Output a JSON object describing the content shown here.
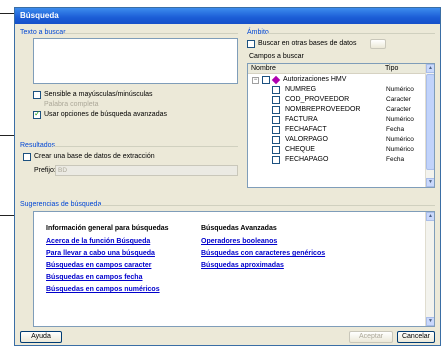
{
  "window": {
    "title": "Búsqueda"
  },
  "left": {
    "text_group_title": "Texto a buscar",
    "text_value": "",
    "case_sensitive": {
      "label": "Sensible a mayúsculas/minúsculas",
      "checked": false
    },
    "whole_word": {
      "label": "Palabra completa",
      "checked": false,
      "disabled": true
    },
    "advanced": {
      "label": "Usar opciones de búsqueda avanzadas",
      "checked": true
    },
    "results_group_title": "Resultados",
    "create_db": {
      "label": "Crear una base de datos de extracción",
      "checked": false
    },
    "prefix_label": "Prefijo:",
    "prefix_value": "BD"
  },
  "right": {
    "scope_group_title": "Ámbito",
    "other_db": {
      "label": "Buscar en otras bases de datos",
      "checked": false
    },
    "fields_title": "Campos a buscar",
    "columns": {
      "name": "Nombre",
      "type": "Tipo"
    },
    "root": "Autorizaciones HMV",
    "fields": [
      {
        "name": "NUMREG",
        "type": "Numérico"
      },
      {
        "name": "COD_PROVEEDOR",
        "type": "Caracter"
      },
      {
        "name": "NOMBREPROVEEDOR",
        "type": "Caracter"
      },
      {
        "name": "FACTURA",
        "type": "Numérico"
      },
      {
        "name": "FECHAFACT",
        "type": "Fecha"
      },
      {
        "name": "VALORPAGO",
        "type": "Numérico"
      },
      {
        "name": "CHEQUE",
        "type": "Numérico"
      },
      {
        "name": "FECHAPAGO",
        "type": "Fecha"
      }
    ]
  },
  "suggestions": {
    "group_title": "Sugerencias de búsqueda",
    "general_heading": "Información general para búsquedas",
    "general_links": [
      "Acerca de la función Búsqueda",
      "Para llevar a cabo una búsqueda",
      "Búsquedas en campos caracter",
      "Búsquedas en campos fecha",
      "Búsquedas en campos numéricos"
    ],
    "advanced_heading": "Búsquedas Avanzadas",
    "advanced_links": [
      "Operadores booleanos",
      "Búsquedas con caracteres genéricos",
      "Búsquedas aproximadas"
    ]
  },
  "buttons": {
    "help": "Ayuda",
    "accept": "Aceptar",
    "cancel": "Cancelar"
  },
  "colors": {
    "title_bar": "#1b5dd6",
    "link": "#0000cc",
    "group_title": "#0046d5"
  }
}
